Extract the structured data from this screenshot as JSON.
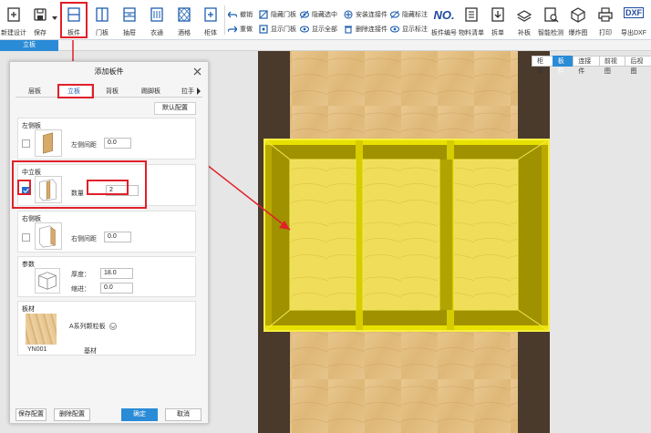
{
  "toolbar": {
    "left": [
      {
        "label": "新建设计",
        "icon": "new-design-icon"
      },
      {
        "label": "保存",
        "icon": "save-icon"
      }
    ],
    "board_tools": [
      {
        "label": "板件",
        "icon": "board-icon"
      },
      {
        "label": "门板",
        "icon": "door-panel-icon"
      },
      {
        "label": "抽屉",
        "icon": "drawer-icon"
      },
      {
        "label": "衣通",
        "icon": "hanging-rail-icon"
      },
      {
        "label": "酒格",
        "icon": "wine-rack-icon"
      },
      {
        "label": "柜体",
        "icon": "cabinet-add-icon"
      }
    ],
    "small_tools": [
      {
        "label": "撤销",
        "icon": "undo-icon"
      },
      {
        "label": "重做",
        "icon": "redo-icon"
      },
      {
        "label": "隐藏门板",
        "icon": "hide-door-icon"
      },
      {
        "label": "显示门板",
        "icon": "show-door-icon"
      },
      {
        "label": "隐藏选中",
        "icon": "hide-selected-icon"
      },
      {
        "label": "显示全部",
        "icon": "show-all-icon"
      },
      {
        "label": "安装连接件",
        "icon": "install-connector-icon"
      },
      {
        "label": "删除连接件",
        "icon": "delete-connector-icon"
      },
      {
        "label": "隐藏标注",
        "icon": "hide-annotation-icon"
      },
      {
        "label": "显示标注",
        "icon": "show-annotation-icon"
      }
    ],
    "right_tools": [
      {
        "label": "板件编号",
        "icon": "board-number-icon",
        "glyph": "NO."
      },
      {
        "label": "物料清单",
        "icon": "material-list-icon"
      },
      {
        "label": "拆单",
        "icon": "split-order-icon"
      },
      {
        "label": "补板",
        "icon": "supplement-board-icon"
      },
      {
        "label": "智能检测",
        "icon": "smart-check-icon"
      },
      {
        "label": "爆炸图",
        "icon": "exploded-view-icon"
      },
      {
        "label": "打印",
        "icon": "print-icon"
      },
      {
        "label": "导出DXF",
        "icon": "export-dxf-icon",
        "glyph": "DXF"
      }
    ]
  },
  "tabstrip": {
    "active": "立板"
  },
  "view_switch": [
    "柜体",
    "板件",
    "连接件",
    "前视图",
    "后视图"
  ],
  "view_switch_active": 1,
  "dialog": {
    "title": "添加板件",
    "tabs": [
      "层板",
      "立板",
      "背板",
      "踢脚板",
      "拉手"
    ],
    "active_tab": 1,
    "default_config": "默认配置",
    "left_side": {
      "title": "左侧板",
      "field_label": "左侧间距",
      "value": "0.0",
      "checked": false
    },
    "middle": {
      "title": "中立板",
      "field_label": "数量",
      "value": "2",
      "checked": true
    },
    "right_side": {
      "title": "右侧板",
      "field_label": "右侧间距",
      "value": "0.0",
      "checked": false
    },
    "params": {
      "title": "参数",
      "thickness_label": "厚度：",
      "thickness": "18.0",
      "shrink_label": "缩进：",
      "shrink": "0.0"
    },
    "material": {
      "title": "板材",
      "code": "YN001",
      "select": "A系列颗粒板",
      "base_label": "基材"
    },
    "buttons": {
      "save": "保存配置",
      "delete": "删除配置",
      "ok": "确定",
      "cancel": "取消"
    }
  },
  "colors": {
    "accent": "#2a8bd6",
    "highlight": "#e0202a",
    "selection": "#e8e000"
  }
}
